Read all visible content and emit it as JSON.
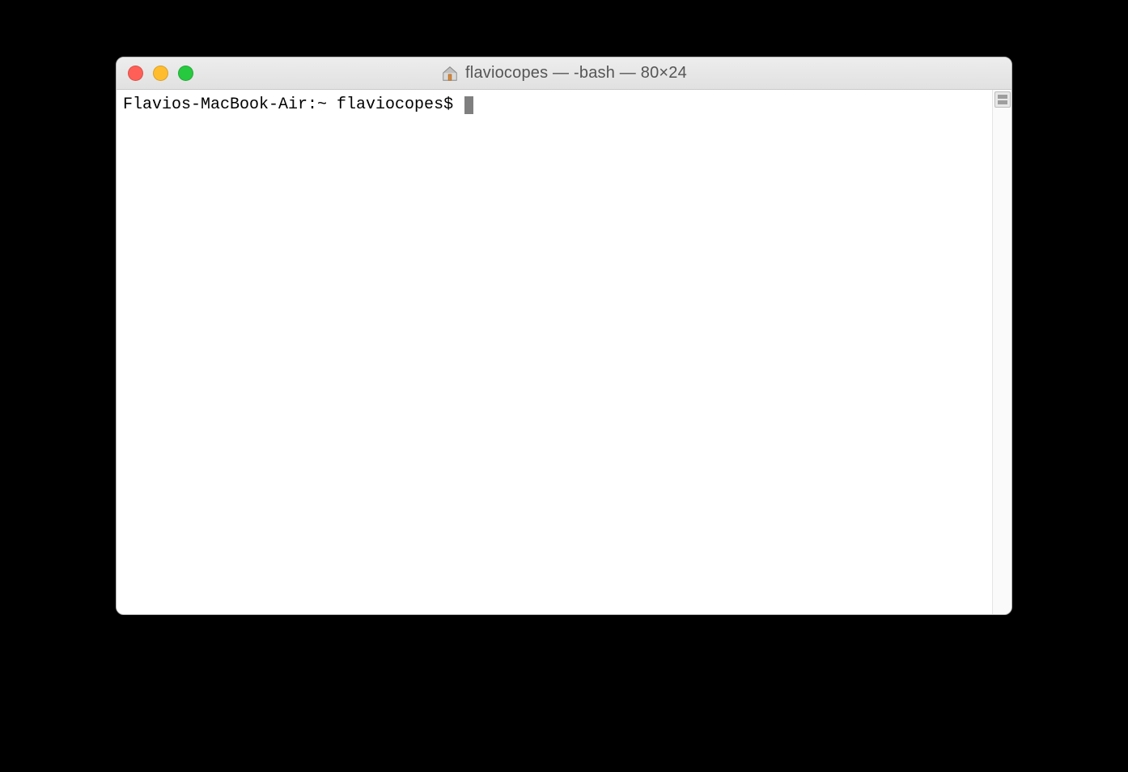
{
  "window": {
    "title": "flaviocopes — -bash — 80×24"
  },
  "terminal": {
    "prompt": "Flavios-MacBook-Air:~ flaviocopes$ "
  }
}
